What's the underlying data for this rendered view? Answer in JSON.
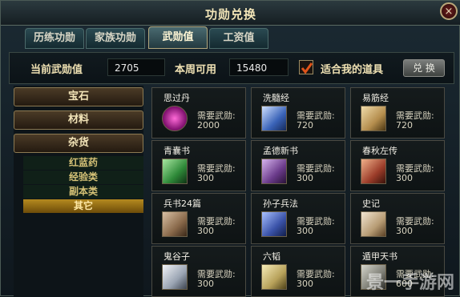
{
  "window": {
    "title": "功勋兑换",
    "close_label": "×"
  },
  "tabs": [
    {
      "label": "历练功勋",
      "active": false
    },
    {
      "label": "家族功勋",
      "active": false
    },
    {
      "label": "武勋值",
      "active": true
    },
    {
      "label": "工资值",
      "active": false
    }
  ],
  "stats": {
    "current_label": "当前武勋值",
    "current_value": "2705",
    "weekly_label": "本周可用",
    "weekly_value": "15480",
    "filter_label": "适合我的道具",
    "filter_checked": true,
    "exchange_button": "兑 换"
  },
  "categories": [
    "宝石",
    "材料",
    "杂货"
  ],
  "subcategories": [
    {
      "label": "红蓝药",
      "selected": false
    },
    {
      "label": "经验类",
      "selected": false
    },
    {
      "label": "副本类",
      "selected": false
    },
    {
      "label": "其它",
      "selected": true
    }
  ],
  "req_label": "需要武勋:",
  "items": [
    {
      "name": "思过丹",
      "cost": "2000",
      "icon": "purple-orb-icon",
      "color": "#b0269b"
    },
    {
      "name": "洗髓经",
      "cost": "720",
      "icon": "blue-scroll-icon",
      "color": "#3a63b8"
    },
    {
      "name": "易筋经",
      "cost": "720",
      "icon": "tan-book-icon",
      "color": "#b58e4e"
    },
    {
      "name": "青囊书",
      "cost": "300",
      "icon": "green-book-icon",
      "color": "#2f8a39"
    },
    {
      "name": "孟德新书",
      "cost": "300",
      "icon": "purple-book-icon",
      "color": "#6b3b8b"
    },
    {
      "name": "春秋左传",
      "cost": "300",
      "icon": "red-book-icon",
      "color": "#9c3d2a"
    },
    {
      "name": "兵书24篇",
      "cost": "300",
      "icon": "brown-book-icon",
      "color": "#8a6a4b"
    },
    {
      "name": "孙子兵法",
      "cost": "300",
      "icon": "blue-book-icon",
      "color": "#3a52a8"
    },
    {
      "name": "史记",
      "cost": "300",
      "icon": "beige-scroll-icon",
      "color": "#b79c74"
    },
    {
      "name": "鬼谷子",
      "cost": "300",
      "icon": "white-book-icon",
      "color": "#9aa4b2"
    },
    {
      "name": "六韬",
      "cost": "300",
      "icon": "yellow-book-icon",
      "color": "#b7a15a"
    },
    {
      "name": "遁甲天书",
      "cost": "600",
      "icon": "gray-book-icon",
      "color": "#7d7d74"
    }
  ],
  "watermark": "景一手游网"
}
